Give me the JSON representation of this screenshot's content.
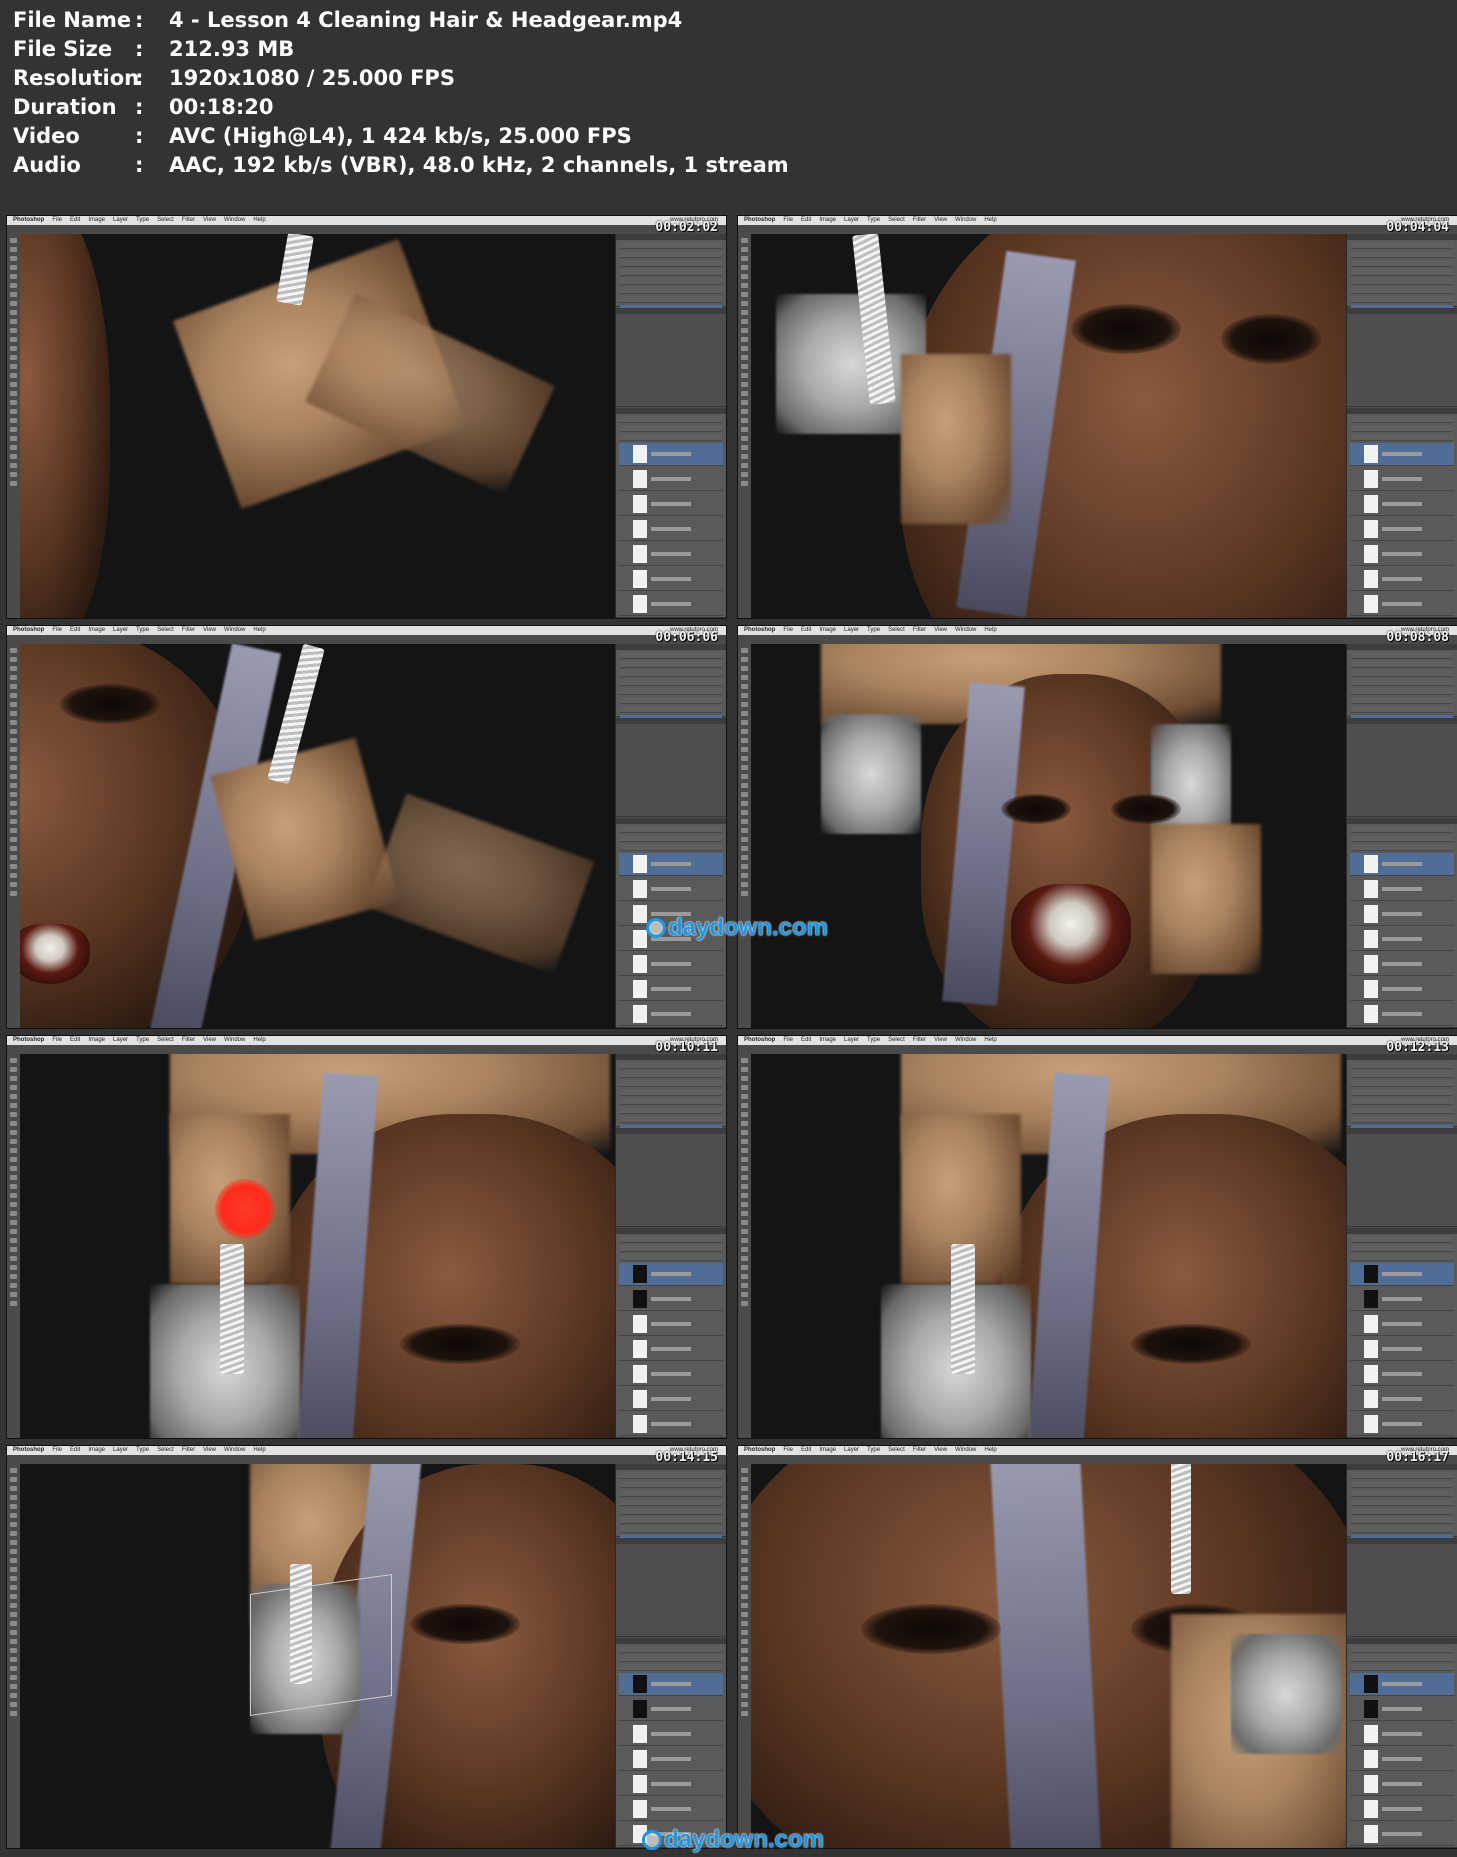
{
  "file_info": [
    {
      "key": "File Name",
      "value": "4 - Lesson 4 Cleaning Hair & Headgear.mp4"
    },
    {
      "key": "File Size",
      "value": "212.93 MB"
    },
    {
      "key": "Resolution",
      "value": "1920x1080 / 25.000 FPS"
    },
    {
      "key": "Duration",
      "value": "00:18:20"
    },
    {
      "key": "Video",
      "value": "AVC (High@L4), 1 424 kb/s, 25.000 FPS"
    },
    {
      "key": "Audio",
      "value": "AAC, 192 kb/s (VBR), 48.0 kHz, 2 channels, 1 stream"
    }
  ],
  "separator": ":",
  "app_menu": [
    "Photoshop",
    "File",
    "Edit",
    "Image",
    "Layer",
    "Type",
    "Select",
    "Filter",
    "View",
    "Window",
    "Help"
  ],
  "menu_right": "www.retutpro.com",
  "frames": [
    {
      "timecode": "00:02:02"
    },
    {
      "timecode": "00:04:04"
    },
    {
      "timecode": "00:06:06"
    },
    {
      "timecode": "00:08:08"
    },
    {
      "timecode": "00:10:11"
    },
    {
      "timecode": "00:12:13"
    },
    {
      "timecode": "00:14:15"
    },
    {
      "timecode": "00:16:17"
    }
  ],
  "watermark": {
    "text": "daydown.com",
    "color": "#1c97e6"
  },
  "colors": {
    "background": "#333333",
    "selection": "#4f6d95",
    "brush": "#ff2a1a"
  }
}
